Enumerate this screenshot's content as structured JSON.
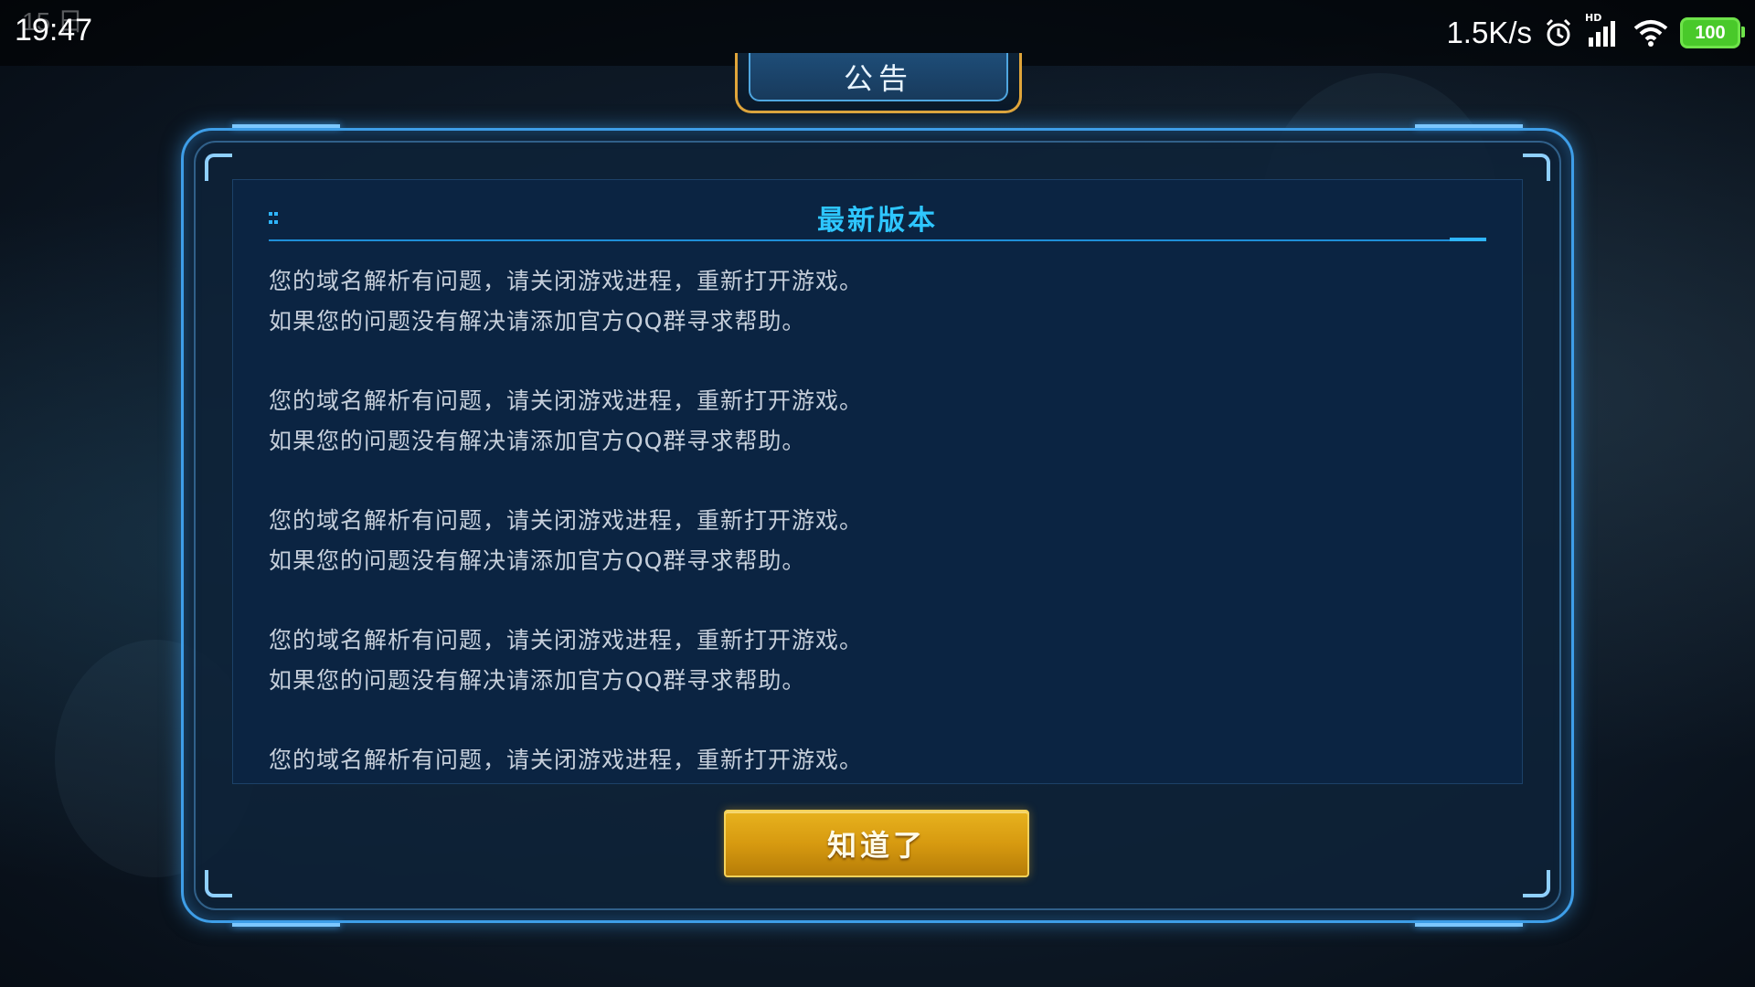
{
  "status_bar": {
    "time": "19:47",
    "ghost_text": "15 日",
    "net_speed": "1.5K/s",
    "hd_label": "HD",
    "battery_level": "100",
    "icons": [
      "alarm-icon",
      "signal-icon",
      "wifi-icon",
      "battery-icon"
    ],
    "battery_color": "#49c92a"
  },
  "dialog": {
    "tab_title": "公告",
    "header_title": "最新版本",
    "paragraphs": [
      {
        "line1": "您的域名解析有问题，请关闭游戏进程，重新打开游戏。",
        "line2": "如果您的问题没有解决请添加官方QQ群寻求帮助。"
      },
      {
        "line1": "您的域名解析有问题，请关闭游戏进程，重新打开游戏。",
        "line2": "如果您的问题没有解决请添加官方QQ群寻求帮助。"
      },
      {
        "line1": "您的域名解析有问题，请关闭游戏进程，重新打开游戏。",
        "line2": "如果您的问题没有解决请添加官方QQ群寻求帮助。"
      },
      {
        "line1": "您的域名解析有问题，请关闭游戏进程，重新打开游戏。",
        "line2": "如果您的问题没有解决请添加官方QQ群寻求帮助。"
      },
      {
        "line1": "您的域名解析有问题，请关闭游戏进程，重新打开游戏。",
        "line2": ""
      }
    ],
    "confirm_label": "知道了",
    "colors": {
      "frame": "#3e9ee8",
      "header_title": "#2ec6ff",
      "button": "#e7b21e",
      "tab_border": "#e0a53a"
    }
  }
}
